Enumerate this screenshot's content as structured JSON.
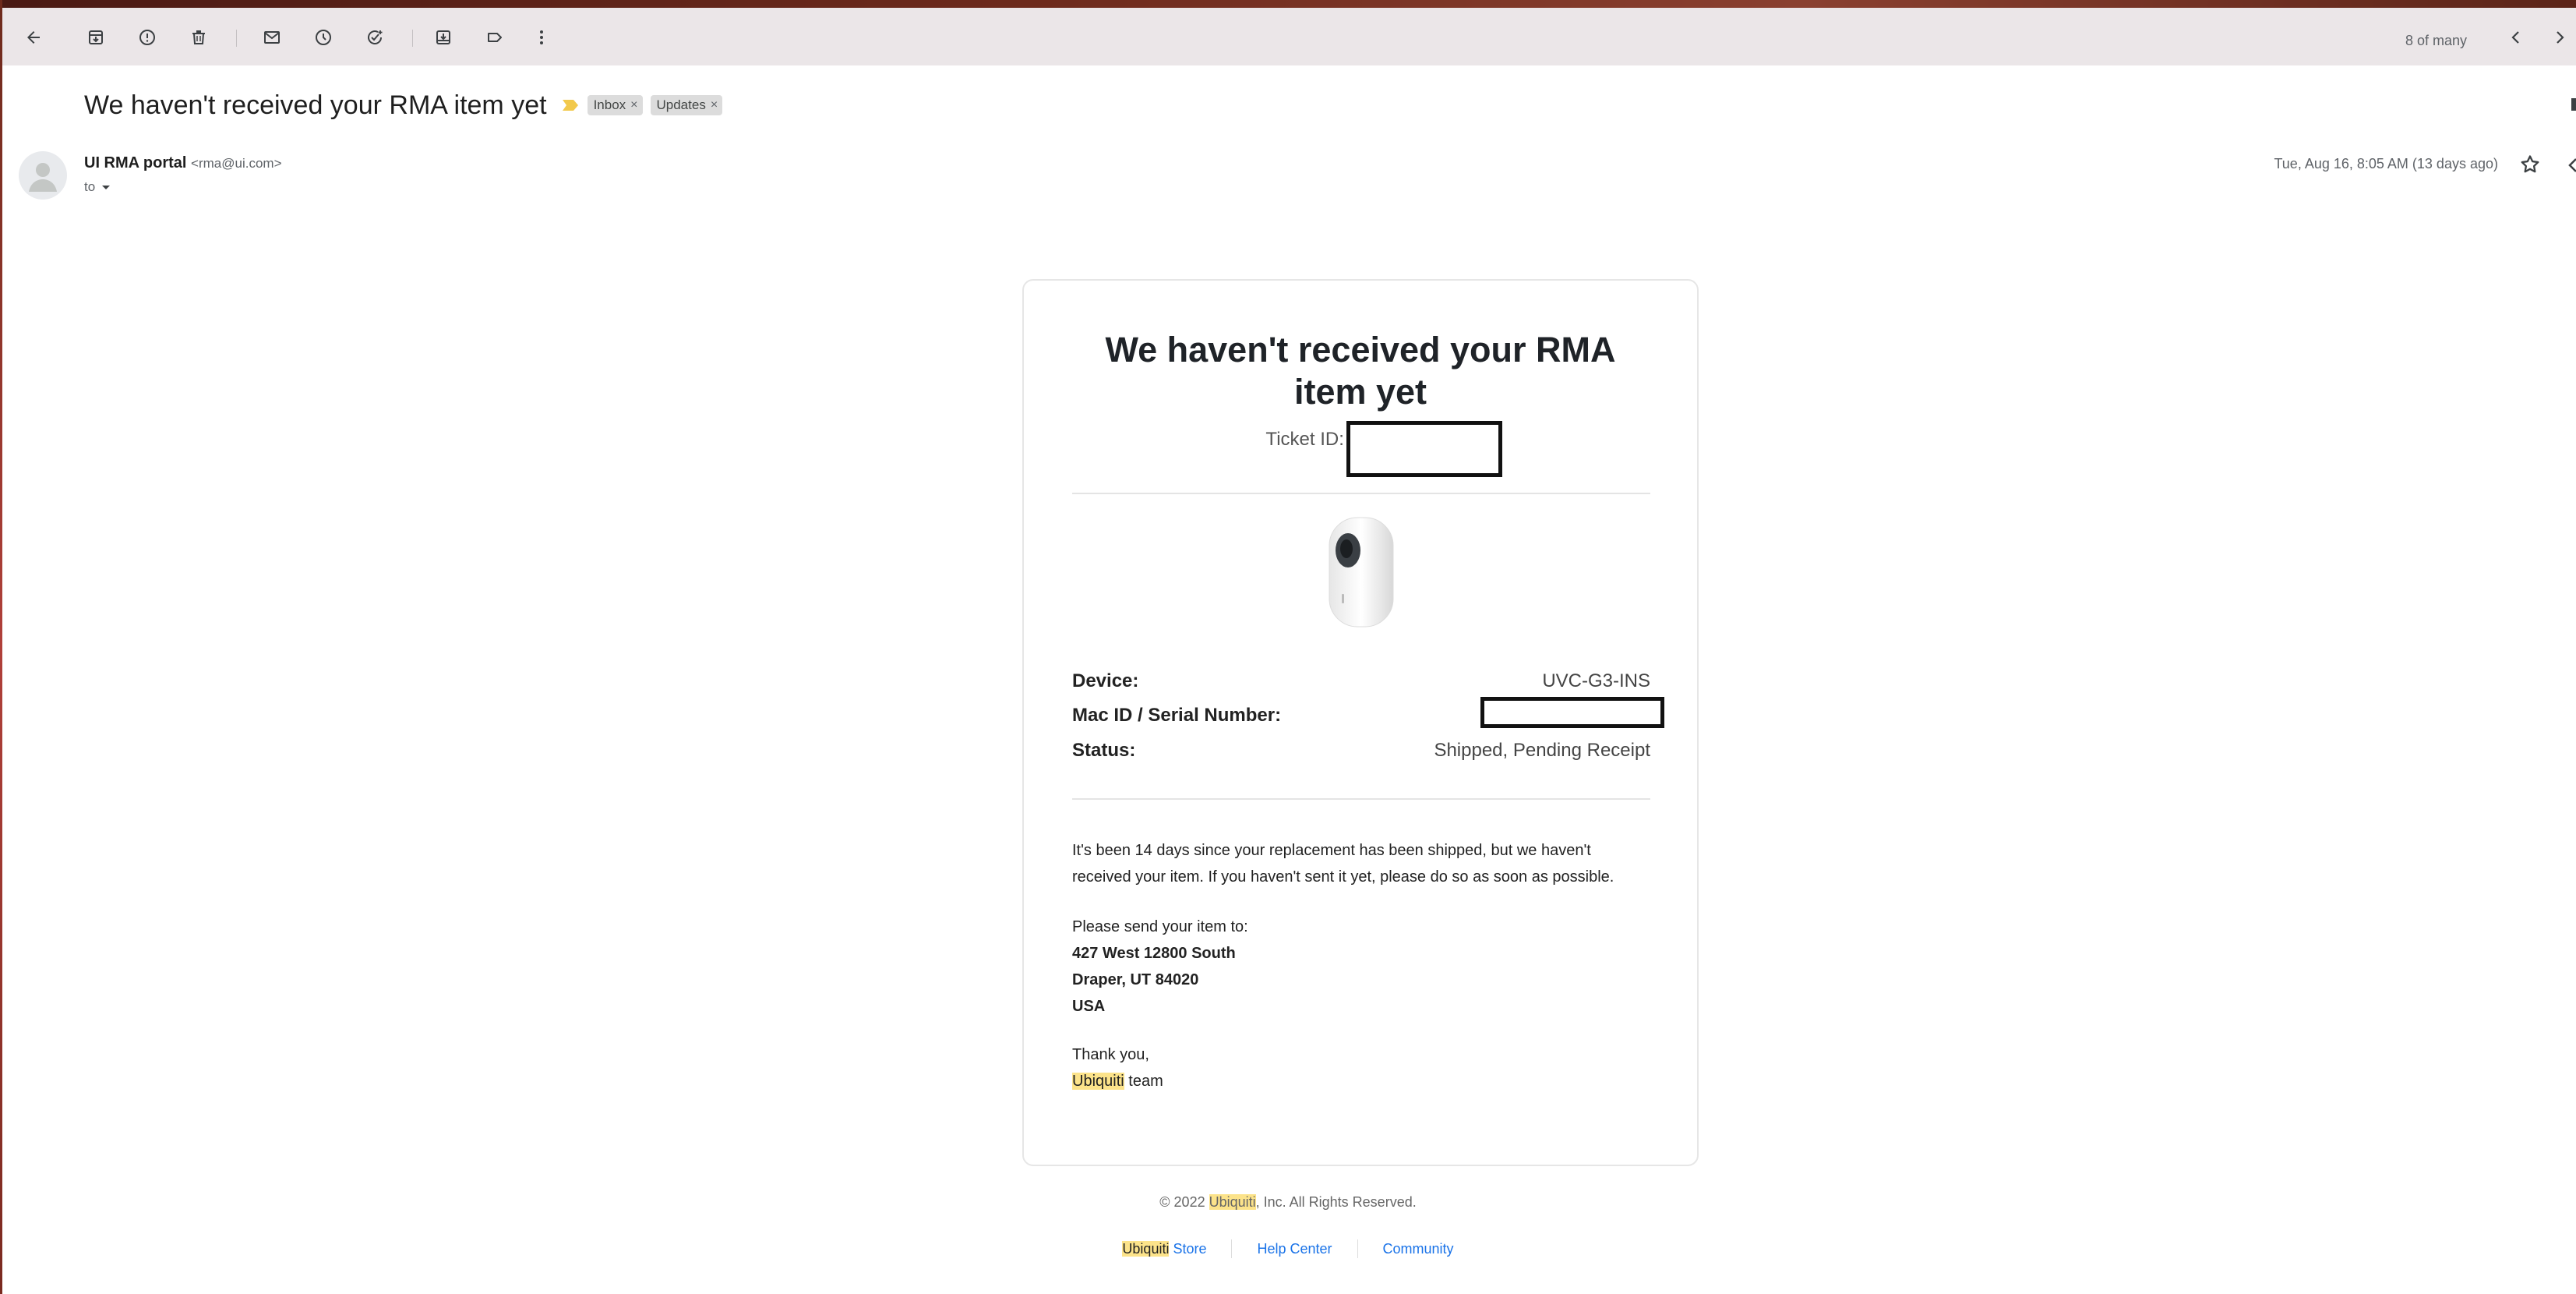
{
  "toolbar": {
    "back_icon": "arrow-left-icon",
    "archive_icon": "archive-icon",
    "spam_icon": "report-spam-icon",
    "delete_icon": "trash-icon",
    "mark_unread_icon": "envelope-icon",
    "snooze_icon": "clock-icon",
    "add_task_icon": "add-task-icon",
    "move_icon": "move-to-icon",
    "label_icon": "label-icon",
    "more_icon": "more-vertical-icon",
    "pager_text": "8 of many"
  },
  "email": {
    "subject": "We haven't received your RMA item yet",
    "labels": [
      "Inbox",
      "Updates"
    ],
    "sender_name": "UI RMA portal",
    "sender_email": "<rma@ui.com>",
    "to_label": "to",
    "date": "Tue, Aug 16, 8:05 AM (13 days ago)"
  },
  "card": {
    "title": "We haven't received your RMA item yet",
    "ticket_label": "Ticket ID: V",
    "details": [
      {
        "key": "Device:",
        "value": "UVC-G3-INS"
      },
      {
        "key": "Mac ID / Serial Number:",
        "value": ""
      },
      {
        "key": "Status:",
        "value": "Shipped, Pending Receipt"
      }
    ],
    "paragraph": "It's been 14 days since your replacement has been shipped, but we haven't received your item. If you haven't sent it yet, please do so as soon as possible.",
    "send_to_label": "Please send your item to:",
    "address": [
      "427 West 12800 South",
      "Draper, UT 84020",
      "USA"
    ],
    "thanks": "Thank you,",
    "signature_brand": "Ubiquiti",
    "signature_rest": " team"
  },
  "footer": {
    "copy_prefix": "© 2022 ",
    "copy_brand": "Ubiquiti",
    "copy_suffix": ", Inc. All Rights Reserved.",
    "store_brand": "Ubiquiti",
    "store_rest": " Store",
    "help_center": "Help Center",
    "community": "Community"
  },
  "colors": {
    "highlight": "#fce38a",
    "link": "#1a73e8",
    "importance_marker": "#f2c94c"
  }
}
